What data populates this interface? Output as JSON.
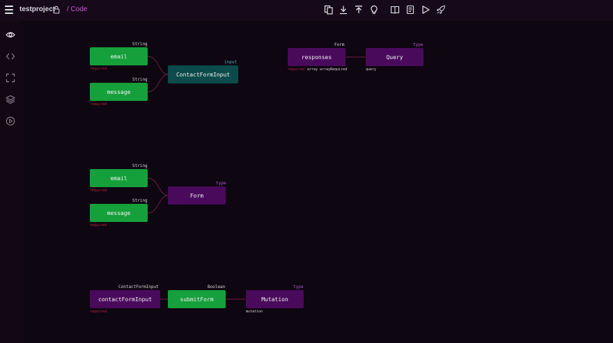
{
  "header": {
    "project_name": "testproject",
    "breadcrumb": "/ Code",
    "tools": [
      "copy-icon",
      "download-icon",
      "upload-icon",
      "lightbulb-icon",
      "book-icon",
      "document-icon",
      "play-icon",
      "rocket-icon"
    ]
  },
  "sidebar": {
    "items": [
      "eye-icon",
      "code-icon",
      "fullscreen-icon",
      "layers-icon",
      "play-circle-icon"
    ]
  },
  "nodes": {
    "email1": {
      "label": "email",
      "type": "String",
      "meta": "required"
    },
    "message1": {
      "label": "message",
      "type": "String",
      "meta": "required"
    },
    "contact_input": {
      "label": "ContactFormInput",
      "type": "input"
    },
    "responses": {
      "label": "responses",
      "type": "Form",
      "meta_required": "required",
      "meta_array": "array arrayRequired"
    },
    "query": {
      "label": "Query",
      "type": "type",
      "meta": "query"
    },
    "email2": {
      "label": "email",
      "type": "String",
      "meta": "required"
    },
    "message2": {
      "label": "message",
      "type": "String",
      "meta": "required"
    },
    "form": {
      "label": "Form",
      "type": "type"
    },
    "contact_arg": {
      "label": "contactFormInput",
      "type": "ContactFormInput",
      "meta": "required"
    },
    "submit_form": {
      "label": "submitForm",
      "type": "Boolean"
    },
    "mutation": {
      "label": "Mutation",
      "type": "type",
      "meta": "mutation"
    }
  },
  "colors": {
    "background": "#0e0611",
    "field_node": "#16a03c",
    "type_node": "#4a0a5c",
    "input_node": "#0c4a4c",
    "accent": "#d64fd9",
    "required_text": "#b82545",
    "wire": "#6e1f3c"
  }
}
